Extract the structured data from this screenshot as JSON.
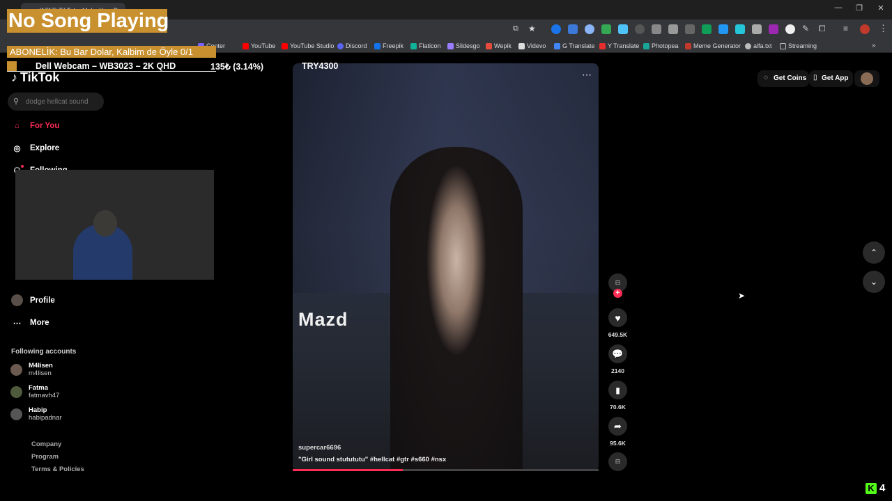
{
  "browser": {
    "tab_title": "(1717) TikTok - Make Your Day",
    "window_controls": [
      "—",
      "❐",
      "✕"
    ],
    "bookmarks": [
      {
        "label": "Center",
        "color": "#7b61ff"
      },
      {
        "label": "YouTube",
        "color": "#ff0000"
      },
      {
        "label": "YouTube Studio",
        "color": "#ff0000"
      },
      {
        "label": "Discord",
        "color": "#5865f2"
      },
      {
        "label": "Freepik",
        "color": "#1273eb"
      },
      {
        "label": "Flaticon",
        "color": "#10b29a"
      },
      {
        "label": "Slidesgo",
        "color": "#9a7cff"
      },
      {
        "label": "Wepik",
        "color": "#e64b3b"
      },
      {
        "label": "Videvo",
        "color": "#dddddd"
      },
      {
        "label": "G Translate",
        "color": "#4285f4"
      },
      {
        "label": "Y Translate",
        "color": "#e62e2e"
      },
      {
        "label": "Photopea",
        "color": "#18a497"
      },
      {
        "label": "Meme Generator",
        "color": "#c0392b"
      },
      {
        "label": "alfa.txt",
        "color": "#bbbbbb"
      },
      {
        "label": "Streaming",
        "color": "#bbbbbb"
      }
    ]
  },
  "overlay": {
    "song": "No Song Playing",
    "subscriber_goal": "ABONELİK: Bu Bar Dolar, Kalbim de Öyle 0/1",
    "ticker": {
      "product": "Dell Webcam – WB3023 – 2K QHD",
      "change": "135₺ (3.14%)",
      "price": "TRY4300"
    },
    "kick_count": "4"
  },
  "tiktok": {
    "logo": "TikTok",
    "search_placeholder": "dodge hellcat sound",
    "nav": {
      "for_you": "For You",
      "explore": "Explore",
      "following": "Following",
      "profile": "Profile",
      "more": "More"
    },
    "following_accounts_heading": "Following accounts",
    "following_accounts": [
      {
        "name": "M4lisen",
        "handle": "m4lisen"
      },
      {
        "name": "Fatma",
        "handle": "fatmavh47"
      },
      {
        "name": "Habip",
        "handle": "habipadnar"
      }
    ],
    "footer_links": [
      "Company",
      "Program",
      "Terms & Policies"
    ],
    "header": {
      "get_coins": "Get Coins",
      "get_app": "Get App"
    },
    "video": {
      "overlay_text": "Mazd",
      "author": "supercar6696",
      "caption": "\"Girl sound stutututu\" #hellcat #gtr #s660 #nsx",
      "likes": "649.5K",
      "comments": "2140",
      "saves": "70.6K",
      "shares": "95.6K",
      "progress_percent": 36,
      "brand_color": "#fe2c55"
    }
  }
}
